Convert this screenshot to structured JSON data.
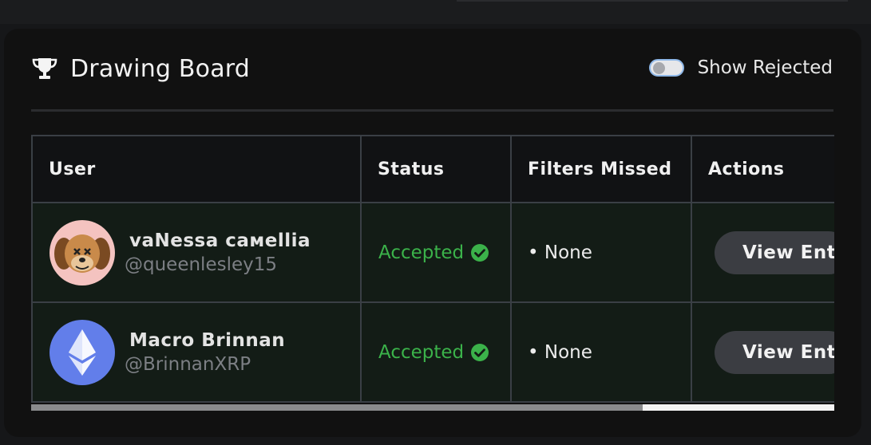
{
  "header": {
    "title": "Drawing Board",
    "icon": "trophy-icon"
  },
  "toggle": {
    "label": "Show Rejected",
    "checked": false
  },
  "table": {
    "columns": [
      "User",
      "Status",
      "Filters Missed",
      "Actions"
    ],
    "rows": [
      {
        "name": "vaNessa caмellia",
        "handle": "@queenlesley15",
        "avatar": "dog-avatar",
        "status": "Accepted",
        "filters": "• None",
        "action": "View Entry"
      },
      {
        "name": "Macro Brinnan",
        "handle": "@BrinnanXRP",
        "avatar": "ethereum-avatar",
        "status": "Accepted",
        "filters": "• None",
        "action": "View Entry"
      }
    ]
  },
  "colors": {
    "accepted": "#3bb24a",
    "card_bg": "#111111",
    "row_bg": "#131c16"
  },
  "scroll": {
    "horizontal_fraction_visible": 0.76
  }
}
